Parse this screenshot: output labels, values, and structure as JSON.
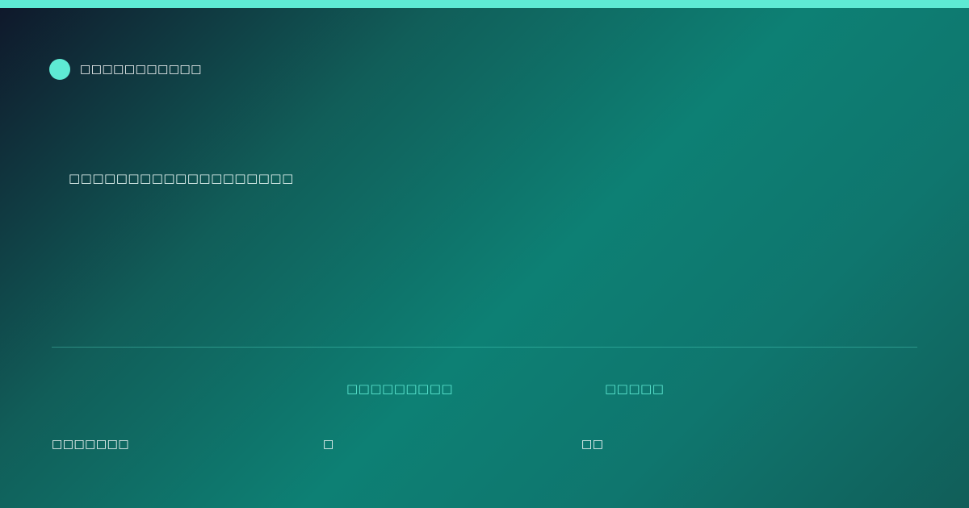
{
  "brand": {
    "name": "□□□□□□□□□□□",
    "accent_color": "#5eead4"
  },
  "tagline": "□□□□□□□□□□□□□□□□□□□",
  "columns": {
    "headers": [
      "□□□□□□□□□",
      "□□□□□"
    ]
  },
  "row": {
    "cells": [
      "□□□□□□□",
      "□",
      "□□"
    ]
  },
  "colors": {
    "accent": "#5eead4",
    "background_dark": "#0f172a",
    "background_teal": "#0d8074"
  }
}
